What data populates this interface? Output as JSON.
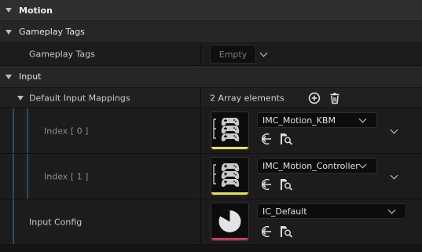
{
  "motion": {
    "title": "Motion"
  },
  "gameplay_tags_category": {
    "title": "Gameplay Tags"
  },
  "gameplay_tags_row": {
    "label": "Gameplay Tags",
    "value": "Empty"
  },
  "input_category": {
    "title": "Input"
  },
  "default_input_mappings": {
    "label": "Default Input Mappings",
    "count": "2 Array elements"
  },
  "mappings": [
    {
      "index_label": "Index [ 0 ]",
      "asset": "IMC_Motion_KBM"
    },
    {
      "index_label": "Index [ 1 ]",
      "asset": "IMC_Motion_Controller"
    }
  ],
  "input_config": {
    "label": "Input Config",
    "asset": "IC_Default"
  },
  "colors": {
    "imc_bar": "#e6e05a",
    "ic_bar": "#c43a5a",
    "guide": "#2a4a63"
  },
  "icons": [
    "chevron-down-icon",
    "add-circle-icon",
    "trash-icon",
    "use-selected-icon",
    "browse-icon",
    "controller-stack-icon",
    "pie-icon"
  ]
}
